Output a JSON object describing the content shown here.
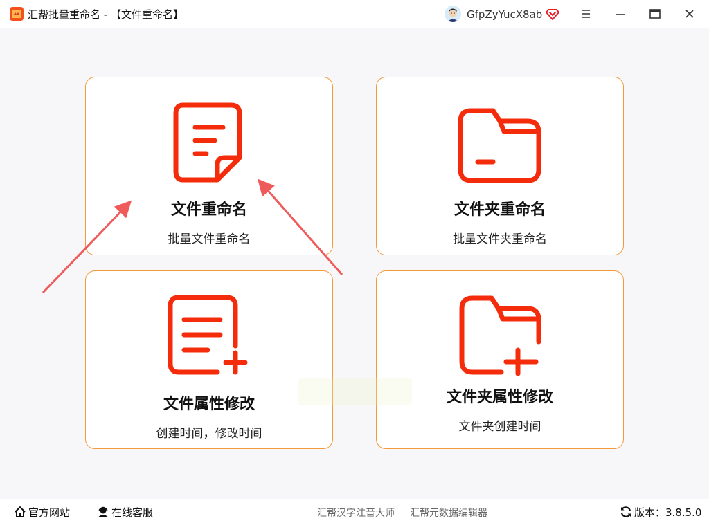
{
  "window": {
    "title": "汇帮批量重命名 - 【文件重命名】",
    "username": "GfpZyYucX8ab"
  },
  "cards": [
    {
      "title": "文件重命名",
      "subtitle": "批量文件重命名",
      "icon": "document-icon"
    },
    {
      "title": "文件夹重命名",
      "subtitle": "批量文件夹重命名",
      "icon": "folder-icon"
    },
    {
      "title": "文件属性修改",
      "subtitle": "创建时间，修改时间",
      "icon": "document-plus-icon"
    },
    {
      "title": "文件夹属性修改",
      "subtitle": "文件夹创建时间",
      "icon": "folder-plus-icon"
    }
  ],
  "statusbar": {
    "website": "官方网站",
    "support": "在线客服",
    "link_pinyin": "汇帮汉字注音大师",
    "link_metadata": "汇帮元数据编辑器",
    "version": "版本：3.8.5.0"
  },
  "colors": {
    "accent": "#f52c0c",
    "card_border": "#f59a3a",
    "arrow": "#ef5a5a"
  }
}
